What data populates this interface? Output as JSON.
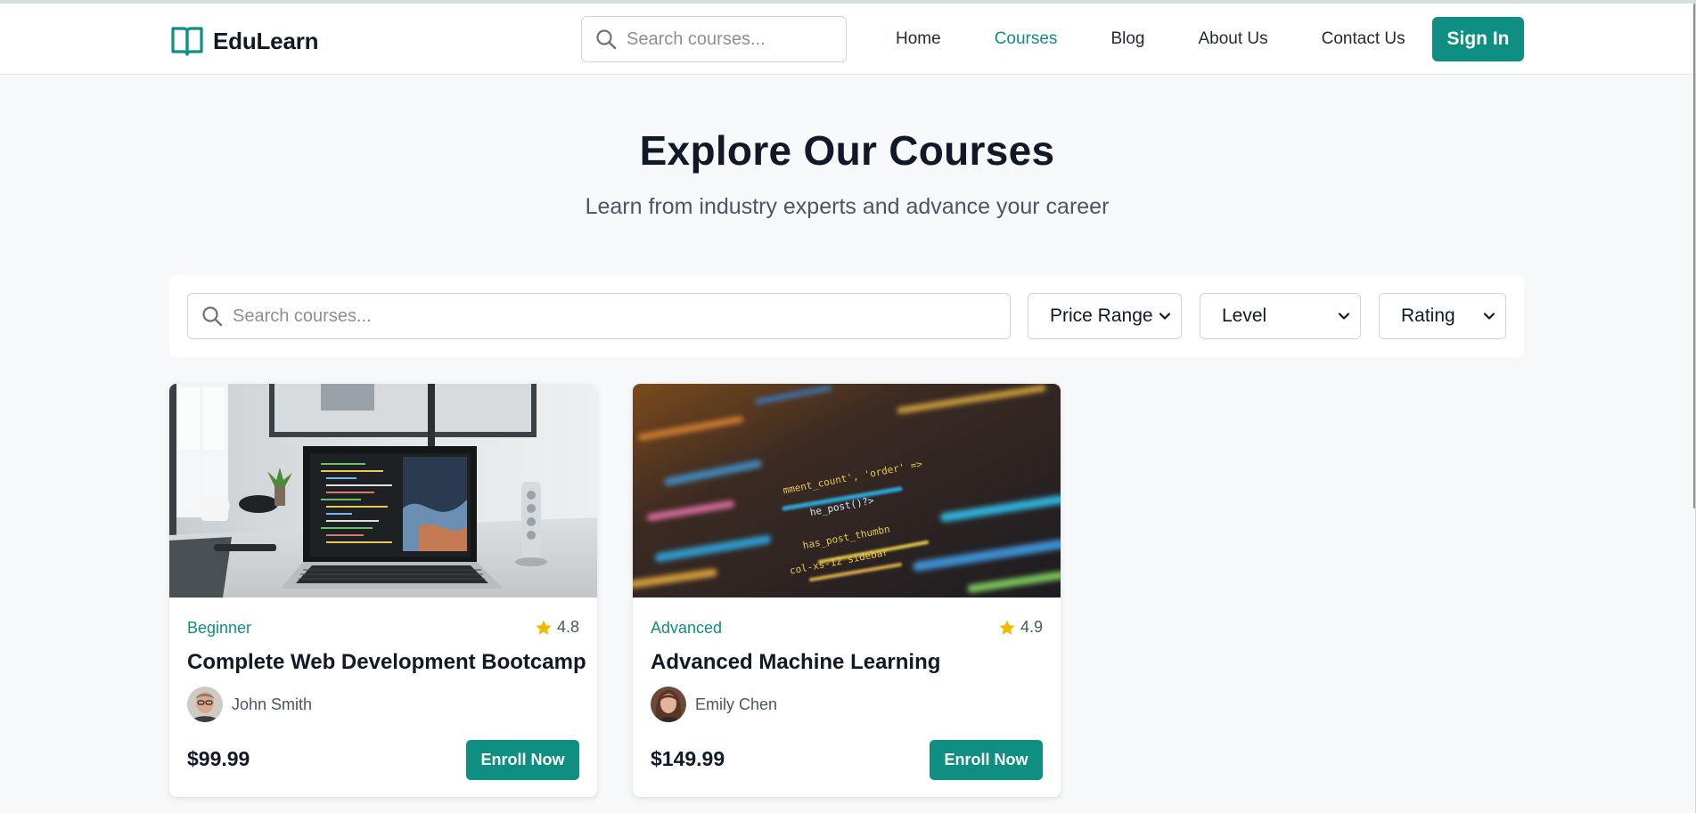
{
  "brand": {
    "name": "EduLearn",
    "icon": "open-book-icon",
    "accent_color": "#0f8f82"
  },
  "header": {
    "search_placeholder": "Search courses...",
    "nav": [
      {
        "label": "Home",
        "active": false
      },
      {
        "label": "Courses",
        "active": true
      },
      {
        "label": "Blog",
        "active": false
      },
      {
        "label": "About Us",
        "active": false
      },
      {
        "label": "Contact Us",
        "active": false
      }
    ],
    "signin_label": "Sign In"
  },
  "hero": {
    "title": "Explore Our Courses",
    "subtitle": "Learn from industry experts and advance your career"
  },
  "filters": {
    "search_placeholder": "Search courses...",
    "price_range": "Price Range",
    "level": "Level",
    "rating": "Rating"
  },
  "courses": [
    {
      "level": "Beginner",
      "rating": "4.8",
      "title": "Complete Web Development Bootcamp",
      "instructor": "John Smith",
      "price": "$99.99",
      "cta": "Enroll Now"
    },
    {
      "level": "Advanced",
      "rating": "4.9",
      "title": "Advanced Machine Learning",
      "instructor": "Emily Chen",
      "price": "$149.99",
      "cta": "Enroll Now"
    }
  ]
}
